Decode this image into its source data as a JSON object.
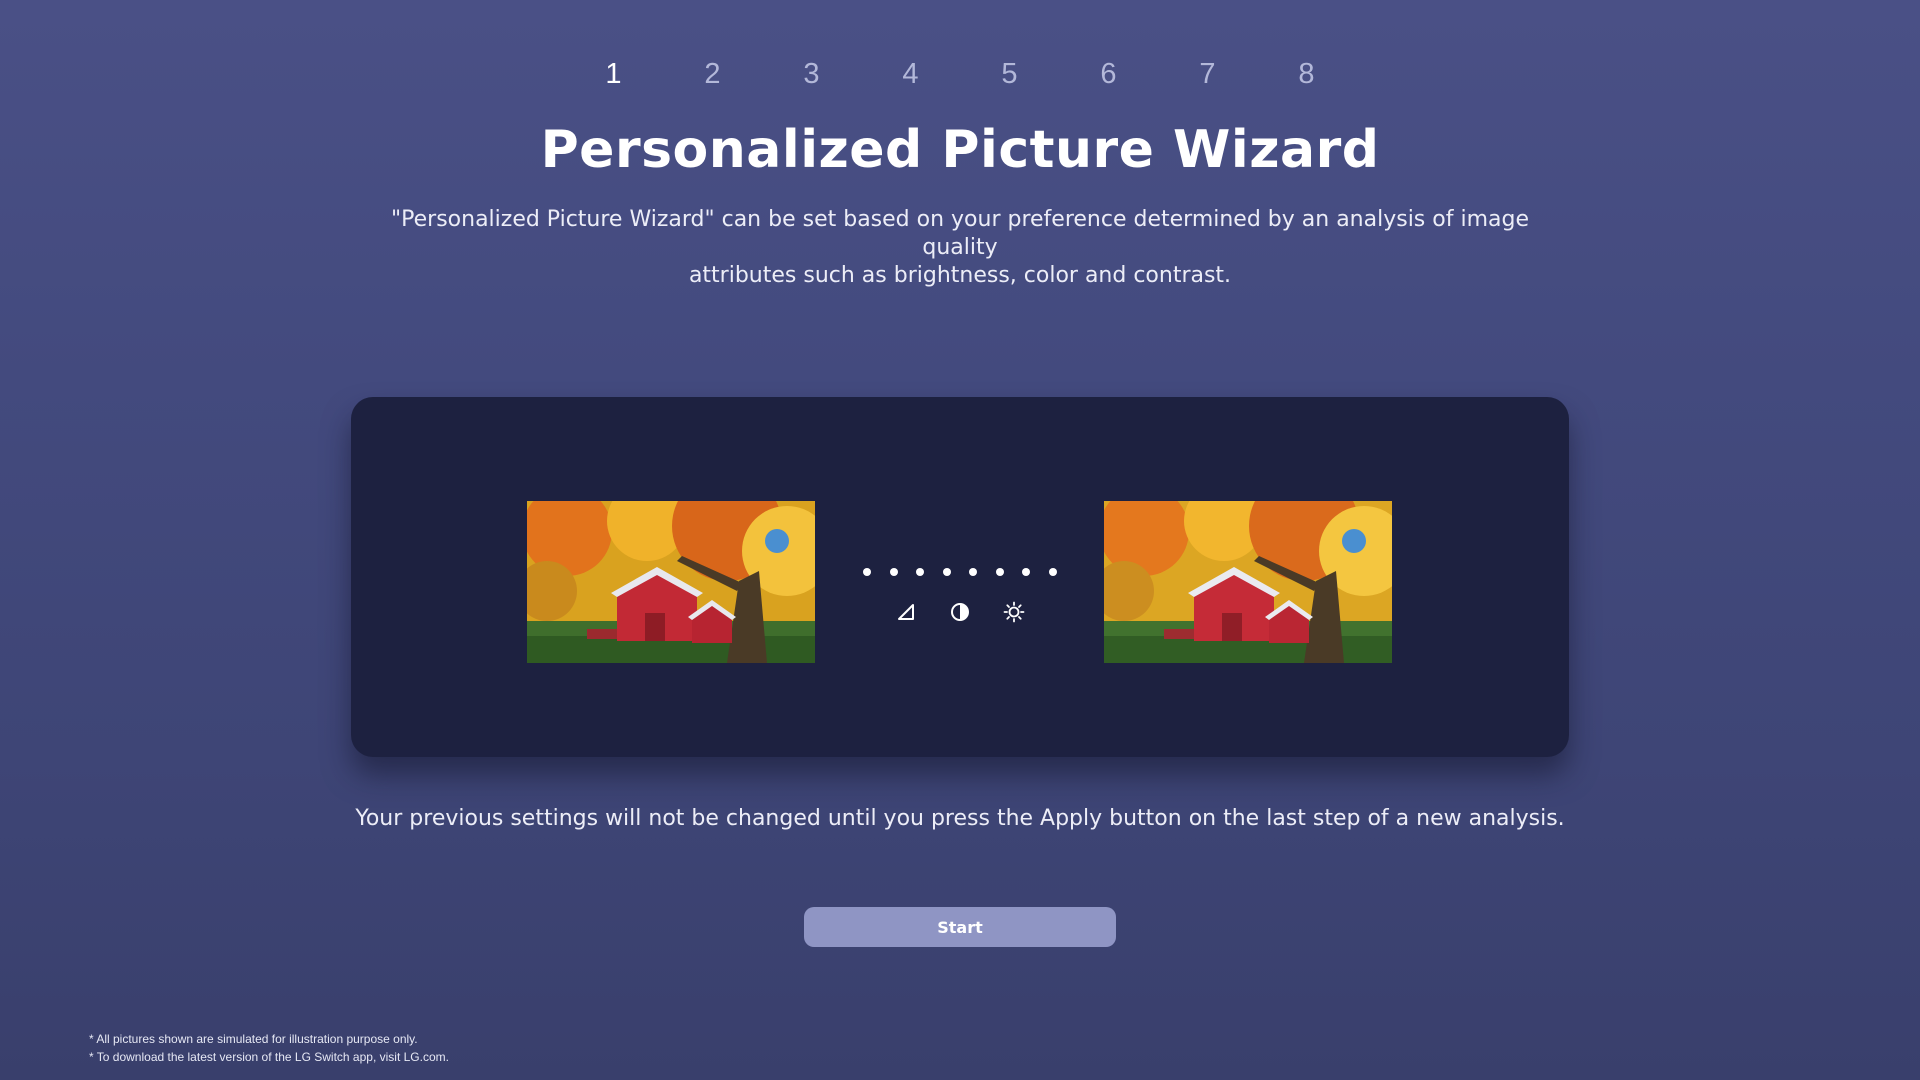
{
  "steps": [
    "1",
    "2",
    "3",
    "4",
    "5",
    "6",
    "7",
    "8"
  ],
  "active_step": "1",
  "title": "Personalized Picture Wizard",
  "subtitle_line1": "\"Personalized Picture Wizard\" can be set based on your preference determined by an analysis of image quality",
  "subtitle_line2": "attributes such as brightness, color and contrast.",
  "preview": {
    "left_image": "barn-autumn-image",
    "right_image": "barn-autumn-image",
    "progress_dots": 8,
    "attribute_icons": [
      "color-icon",
      "contrast-icon",
      "brightness-icon"
    ]
  },
  "note": "Your previous settings will not be changed until you press the Apply button on the last step of a new analysis.",
  "start_label": "Start",
  "footnotes": [
    "* All pictures shown are simulated for illustration purpose only.",
    "* To download the latest version of the LG Switch app, visit LG.com."
  ],
  "colors": {
    "background": "#434a7e",
    "panel": "#1d2140",
    "button": "#8f95c4"
  }
}
